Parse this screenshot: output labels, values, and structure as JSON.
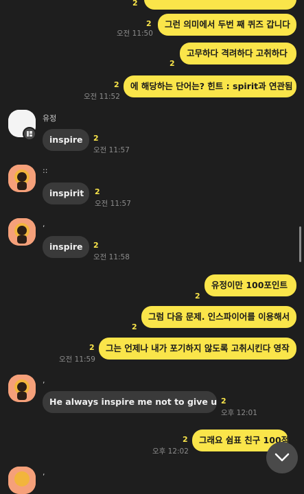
{
  "messages": [
    {
      "text": "그런 의미에서 두번 째 퀴즈 갑니다",
      "unread": "2",
      "time": "오전 11:50"
    },
    {
      "text": "고무하다 격려하다 고취하다",
      "unread": "2"
    },
    {
      "text": "에 해당하는 단어는? 힌트 : spirit과 연관됨",
      "unread": "2",
      "time": "오전 11:52"
    },
    {
      "sender": "유정",
      "text": "inspire",
      "unread": "2",
      "time": "오전 11:57"
    },
    {
      "sender": "::",
      "text": "inspirit",
      "unread": "2",
      "time": "오전 11:57"
    },
    {
      "sender": ",",
      "text": "inspire",
      "unread": "2",
      "time": "오전 11:58"
    },
    {
      "text": "유정이만 100포인트",
      "unread": "2"
    },
    {
      "text": "그럼 다음 문제. 인스파이어를 이용해서",
      "unread": "2"
    },
    {
      "text": "그는 언제나 내가 포기하지 않도록 고취시킨다 영작",
      "unread": "2",
      "time": "오전 11:59"
    },
    {
      "sender": ",",
      "text": "He always inspire me not to give up.",
      "unread": "2",
      "time": "오후 12:01"
    },
    {
      "text": "그래요 쉼표 친구 100점",
      "unread": "2",
      "time": "오후 12:02"
    },
    {
      "sender": ","
    }
  ],
  "top_partial_unread": "2",
  "colors": {
    "my_bubble": "#fae54a",
    "other_bubble": "#3a3a3a",
    "background": "#1e1e1e"
  }
}
